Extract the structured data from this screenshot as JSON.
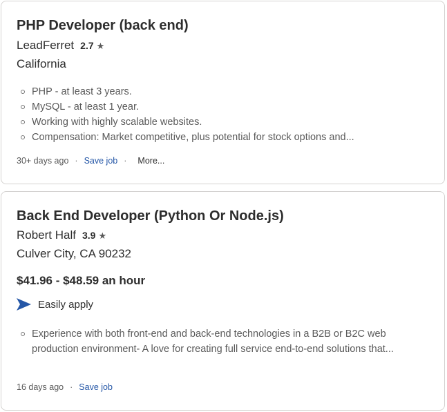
{
  "jobs": [
    {
      "title": "PHP Developer (back end)",
      "company": "LeadFerret",
      "rating": "2.7",
      "star": "★",
      "location": "California",
      "snippet": [
        "PHP - at least 3 years.",
        "MySQL - at least 1 year.",
        "Working with highly scalable websites.",
        "Compensation: Market competitive, plus potential for stock options and..."
      ],
      "posted": "30+ days ago",
      "separator": "·",
      "save_label": "Save job",
      "more_label": "More..."
    },
    {
      "title": "Back End Developer (Python Or Node.js)",
      "company": "Robert Half",
      "rating": "3.9",
      "star": "★",
      "location": "Culver City, CA 90232",
      "salary": "$41.96 - $48.59 an hour",
      "apply_label": "Easily apply",
      "apply_icon": "paper-plane-icon",
      "snippet": [
        "Experience with both front-end and back-end technologies in a B2B or B2C web production environment- A love for creating full service end-to-end solutions that..."
      ],
      "posted": "16 days ago",
      "separator": "·",
      "save_label": "Save job"
    }
  ],
  "colors": {
    "link": "#2557a7",
    "apply_icon": "#2557a7",
    "text": "#2d2d2d",
    "muted": "#595959",
    "border": "#d4d2d0"
  }
}
